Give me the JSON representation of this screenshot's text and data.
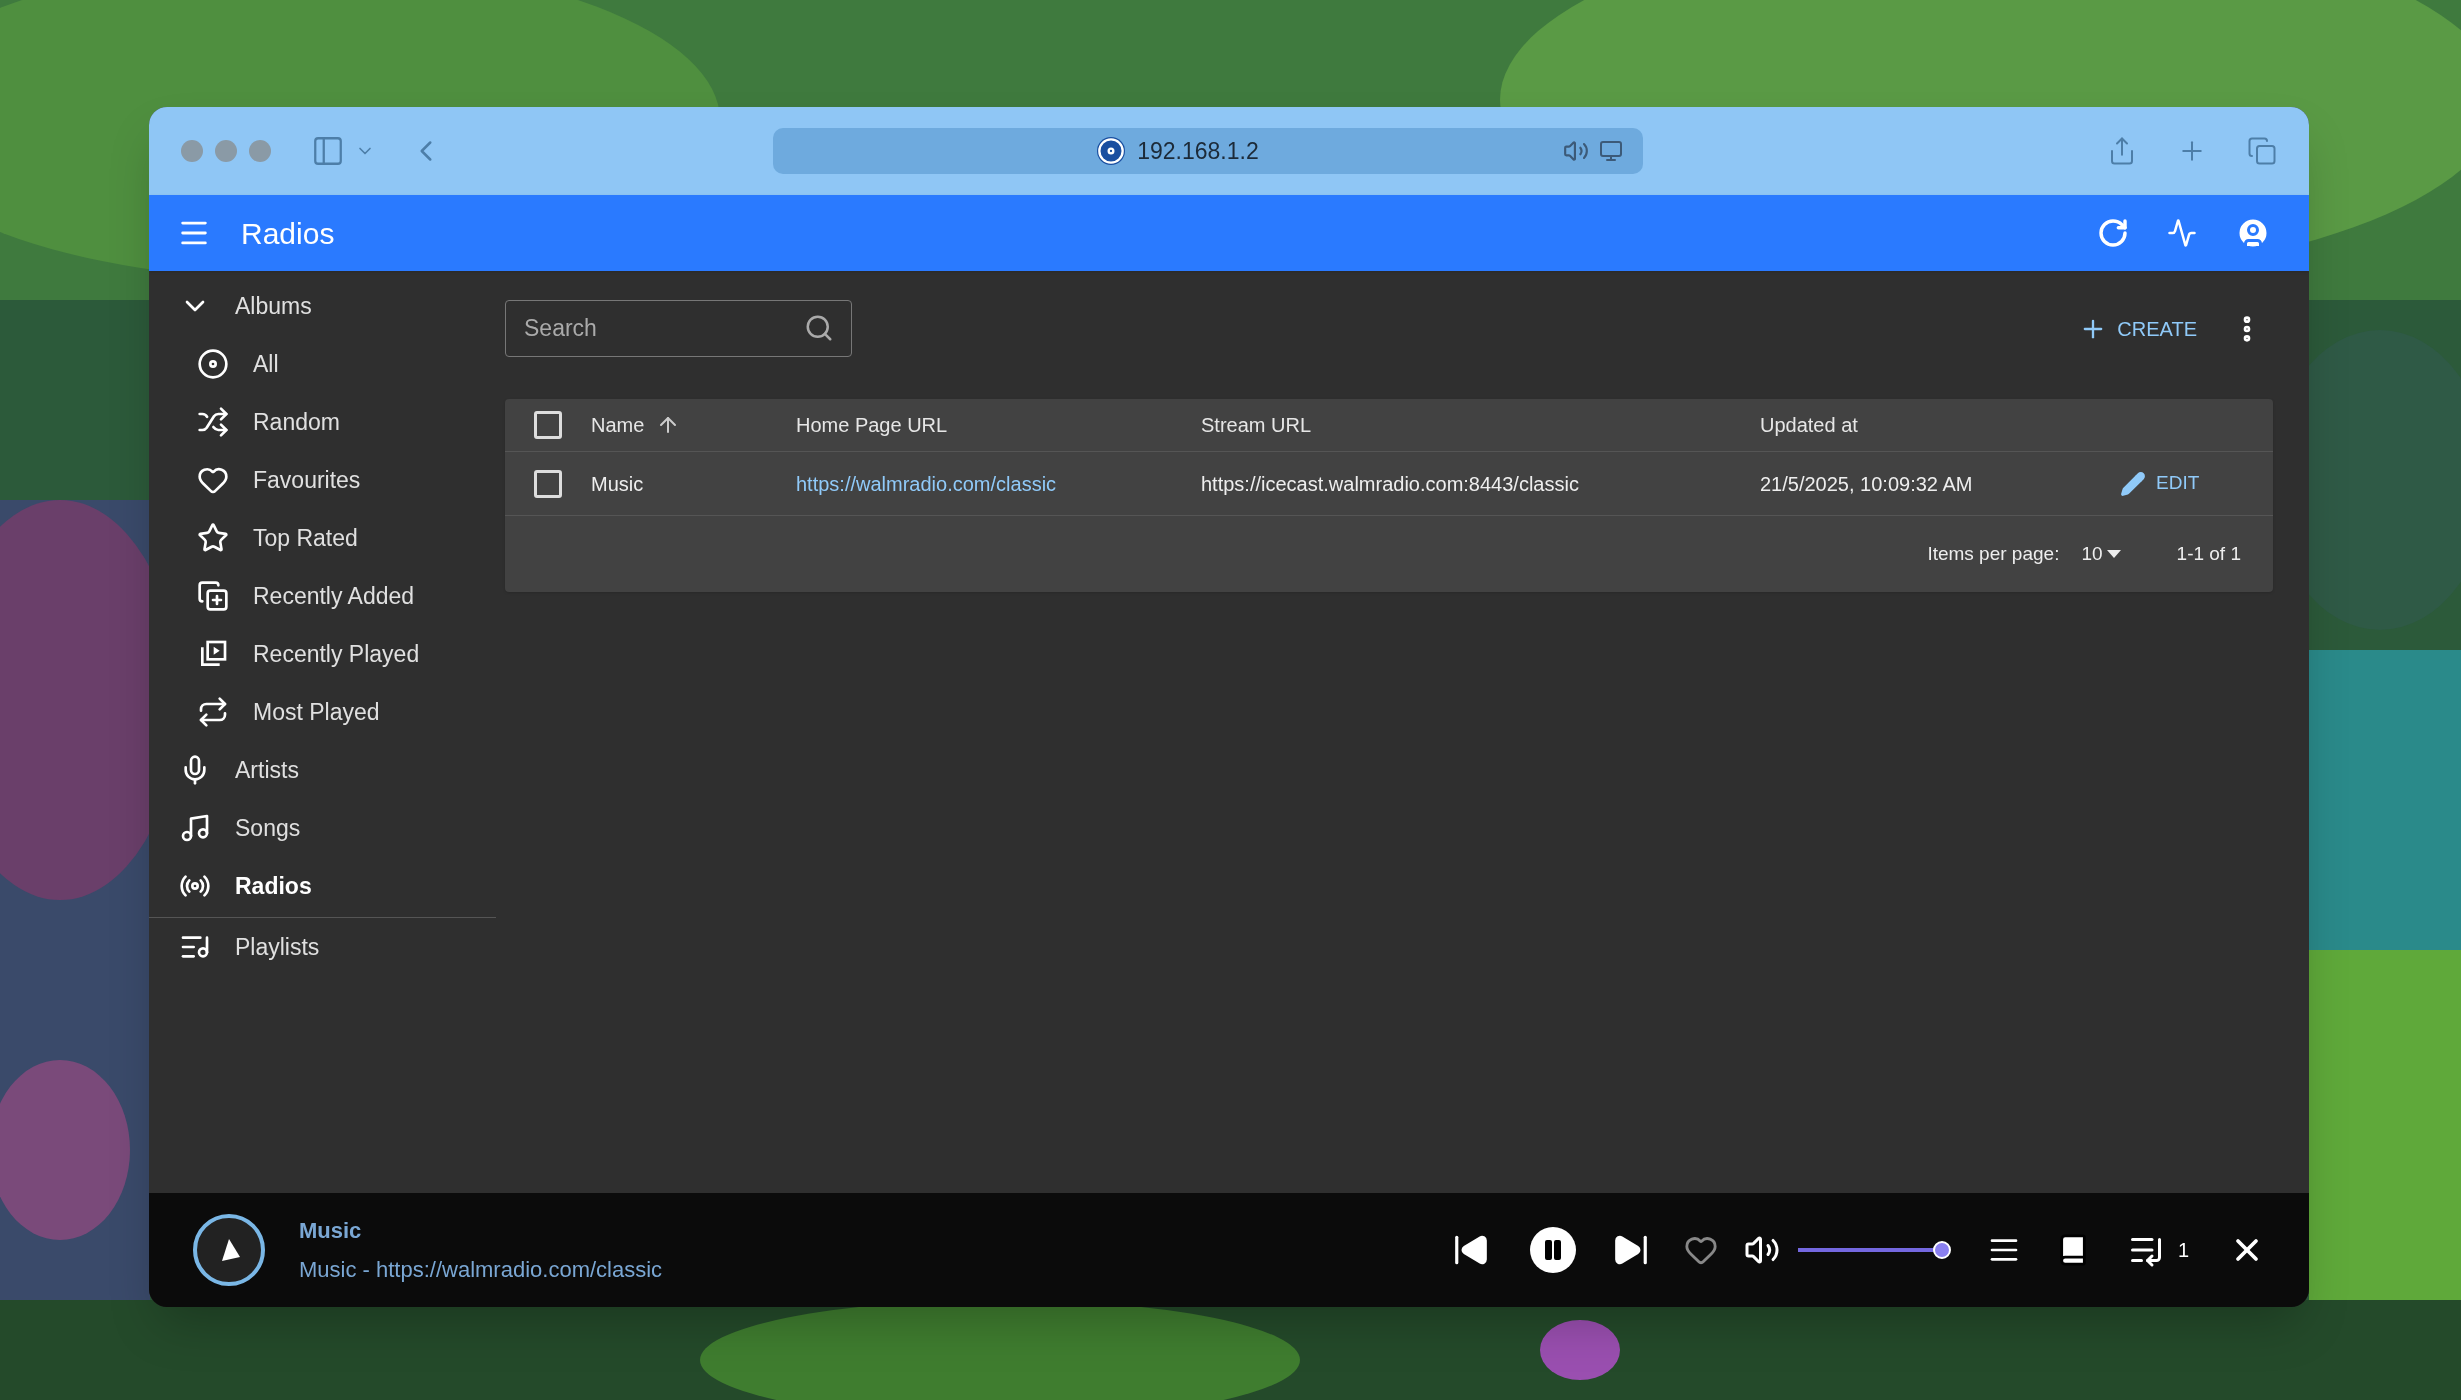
{
  "browser": {
    "url": "192.168.1.2"
  },
  "app_bar": {
    "title": "Radios"
  },
  "sidebar": {
    "items": [
      {
        "label": "Albums",
        "expanded": true,
        "selected": false,
        "children": [
          {
            "label": "All",
            "selected": false
          },
          {
            "label": "Random",
            "selected": false
          },
          {
            "label": "Favourites",
            "selected": false
          },
          {
            "label": "Top Rated",
            "selected": false
          },
          {
            "label": "Recently Added",
            "selected": false
          },
          {
            "label": "Recently Played",
            "selected": false
          },
          {
            "label": "Most Played",
            "selected": false
          }
        ]
      },
      {
        "label": "Artists",
        "selected": false
      },
      {
        "label": "Songs",
        "selected": false
      },
      {
        "label": "Radios",
        "selected": true
      },
      {
        "label": "Playlists",
        "selected": false
      }
    ]
  },
  "toolbar": {
    "search": {
      "placeholder": "Search"
    },
    "create_label": "CREATE"
  },
  "table": {
    "select_all": {
      "checked": false
    },
    "columns": [
      {
        "label": "Name",
        "sorted": true
      },
      {
        "label": "Home Page URL",
        "sorted": false
      },
      {
        "label": "Stream URL",
        "sorted": false
      },
      {
        "label": "Updated at",
        "sorted": false
      }
    ],
    "rows": [
      {
        "checked": false,
        "cells": [
          "Music",
          "https://walmradio.com/classic",
          "https://icecast.walmradio.com:8443/classic",
          "21/5/2025, 10:09:32 AM"
        ],
        "action": "EDIT"
      }
    ],
    "footer": {
      "items_per_page_label": "Items per page:",
      "items_per_page": "10",
      "range": "1-1 of 1"
    }
  },
  "player": {
    "title": "Music",
    "subtitle": "Music - https://walmradio.com/classic",
    "playing": true,
    "favourite": false,
    "volume": {
      "level": 0.95
    },
    "queue_count": "1"
  }
}
